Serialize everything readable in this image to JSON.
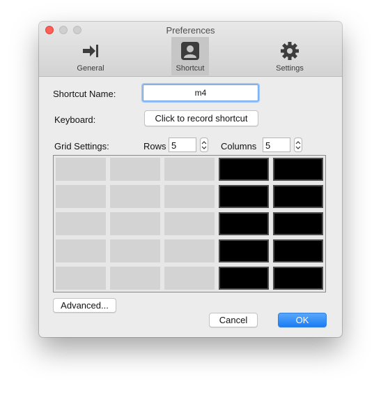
{
  "window": {
    "title": "Preferences"
  },
  "tabs": [
    {
      "label": "General",
      "icon": "arrow-to-bar-icon",
      "selected": false
    },
    {
      "label": "Shortcut",
      "icon": "person-card-icon",
      "selected": true
    },
    {
      "label": "Settings",
      "icon": "gear-icon",
      "selected": false
    }
  ],
  "form": {
    "shortcut_name_label": "Shortcut Name:",
    "shortcut_name_value": "m4",
    "keyboard_label": "Keyboard:",
    "record_button": "Click to record shortcut",
    "grid_settings_label": "Grid Settings:",
    "rows_label": "Rows",
    "rows_value": "5",
    "columns_label": "Columns",
    "columns_value": "5"
  },
  "grid": {
    "rows": 5,
    "columns": 5,
    "selected": [
      [
        false,
        false,
        false,
        true,
        true
      ],
      [
        false,
        false,
        false,
        true,
        true
      ],
      [
        false,
        false,
        false,
        true,
        true
      ],
      [
        false,
        false,
        false,
        true,
        true
      ],
      [
        false,
        false,
        false,
        true,
        true
      ]
    ]
  },
  "buttons": {
    "advanced": "Advanced...",
    "cancel": "Cancel",
    "ok": "OK"
  },
  "colors": {
    "accent": "#1a7cf5",
    "close": "#fd5f57"
  }
}
